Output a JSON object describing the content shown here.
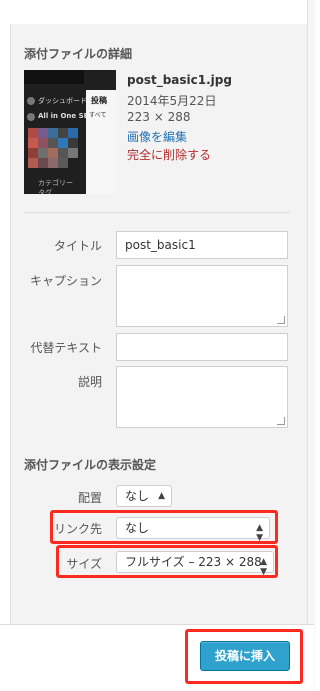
{
  "details": {
    "heading": "添付ファイルの詳細",
    "filename": "post_basic1.jpg",
    "date": "2014年5月22日",
    "dimensions": "223 × 288",
    "edit_link": "画像を編集",
    "delete_link": "完全に削除する",
    "thumbnail": {
      "menu_items": [
        "ダッシュボード",
        "All in One SEO",
        "カテゴリー",
        "タグ"
      ],
      "pane_title": "投稿",
      "pane_sub": "すべて"
    }
  },
  "fields": {
    "title_label": "タイトル",
    "title_value": "post_basic1",
    "caption_label": "キャプション",
    "caption_value": "",
    "alt_label": "代替テキスト",
    "alt_value": "",
    "description_label": "説明",
    "description_value": ""
  },
  "display_settings": {
    "heading": "添付ファイルの表示設定",
    "alignment_label": "配置",
    "alignment_value": "なし",
    "link_label": "リンク先",
    "link_value": "なし",
    "size_label": "サイズ",
    "size_value": "フルサイズ – 223 × 288"
  },
  "footer": {
    "insert_button": "投稿に挿入"
  },
  "colors": {
    "highlight": "#ff2a1f",
    "primary_button": "#2ea2cc",
    "link": "#2271b1",
    "delete": "#b32d2e"
  }
}
